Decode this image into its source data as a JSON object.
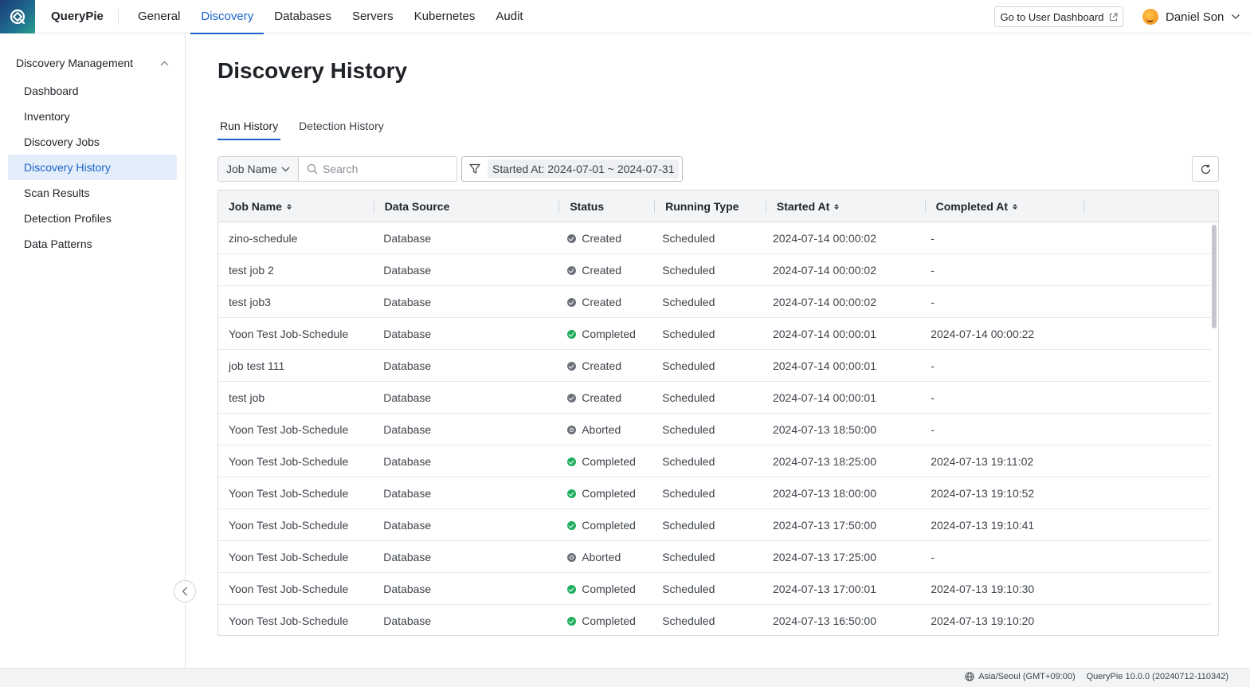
{
  "app": {
    "name": "QueryPie"
  },
  "nav": [
    {
      "label": "General",
      "active": false
    },
    {
      "label": "Discovery",
      "active": true
    },
    {
      "label": "Databases",
      "active": false
    },
    {
      "label": "Servers",
      "active": false
    },
    {
      "label": "Kubernetes",
      "active": false
    },
    {
      "label": "Audit",
      "active": false
    }
  ],
  "header": {
    "dashboard_button": "Go to User Dashboard",
    "user_name": "Daniel Son"
  },
  "sidebar": {
    "section_title": "Discovery Management",
    "items": [
      {
        "label": "Dashboard",
        "active": false
      },
      {
        "label": "Inventory",
        "active": false
      },
      {
        "label": "Discovery Jobs",
        "active": false
      },
      {
        "label": "Discovery History",
        "active": true
      },
      {
        "label": "Scan Results",
        "active": false
      },
      {
        "label": "Detection Profiles",
        "active": false
      },
      {
        "label": "Data Patterns",
        "active": false
      }
    ]
  },
  "main": {
    "title": "Discovery History",
    "tabs": [
      {
        "label": "Run History",
        "active": true
      },
      {
        "label": "Detection History",
        "active": false
      }
    ],
    "filter": {
      "field": "Job Name",
      "search_placeholder": "Search",
      "date_chip": "Started At: 2024-07-01 ~ 2024-07-31"
    },
    "table": {
      "columns": [
        "Job Name",
        "Data Source",
        "Status",
        "Running Type",
        "Started At",
        "Completed At"
      ],
      "rows": [
        {
          "job": "zino-schedule",
          "source": "Database",
          "status": "Created",
          "type": "Scheduled",
          "started": "2024-07-14 00:00:02",
          "completed": "-"
        },
        {
          "job": "test job 2",
          "source": "Database",
          "status": "Created",
          "type": "Scheduled",
          "started": "2024-07-14 00:00:02",
          "completed": "-"
        },
        {
          "job": "test job3",
          "source": "Database",
          "status": "Created",
          "type": "Scheduled",
          "started": "2024-07-14 00:00:02",
          "completed": "-"
        },
        {
          "job": "Yoon Test Job-Schedule",
          "source": "Database",
          "status": "Completed",
          "type": "Scheduled",
          "started": "2024-07-14 00:00:01",
          "completed": "2024-07-14 00:00:22"
        },
        {
          "job": "job test 111",
          "source": "Database",
          "status": "Created",
          "type": "Scheduled",
          "started": "2024-07-14 00:00:01",
          "completed": "-"
        },
        {
          "job": "test job",
          "source": "Database",
          "status": "Created",
          "type": "Scheduled",
          "started": "2024-07-14 00:00:01",
          "completed": "-"
        },
        {
          "job": "Yoon Test Job-Schedule",
          "source": "Database",
          "status": "Aborted",
          "type": "Scheduled",
          "started": "2024-07-13 18:50:00",
          "completed": "-"
        },
        {
          "job": "Yoon Test Job-Schedule",
          "source": "Database",
          "status": "Completed",
          "type": "Scheduled",
          "started": "2024-07-13 18:25:00",
          "completed": "2024-07-13 19:11:02"
        },
        {
          "job": "Yoon Test Job-Schedule",
          "source": "Database",
          "status": "Completed",
          "type": "Scheduled",
          "started": "2024-07-13 18:00:00",
          "completed": "2024-07-13 19:10:52"
        },
        {
          "job": "Yoon Test Job-Schedule",
          "source": "Database",
          "status": "Completed",
          "type": "Scheduled",
          "started": "2024-07-13 17:50:00",
          "completed": "2024-07-13 19:10:41"
        },
        {
          "job": "Yoon Test Job-Schedule",
          "source": "Database",
          "status": "Aborted",
          "type": "Scheduled",
          "started": "2024-07-13 17:25:00",
          "completed": "-"
        },
        {
          "job": "Yoon Test Job-Schedule",
          "source": "Database",
          "status": "Completed",
          "type": "Scheduled",
          "started": "2024-07-13 17:00:01",
          "completed": "2024-07-13 19:10:30"
        },
        {
          "job": "Yoon Test Job-Schedule",
          "source": "Database",
          "status": "Completed",
          "type": "Scheduled",
          "started": "2024-07-13 16:50:00",
          "completed": "2024-07-13 19:10:20"
        }
      ]
    }
  },
  "footer": {
    "timezone": "Asia/Seoul (GMT+09:00)",
    "version": "QueryPie 10.0.0 (20240712-110342)"
  },
  "colors": {
    "accent": "#1a63c9",
    "completed": "#1fae5b",
    "neutral": "#6b7079",
    "active_bg": "#e4eefb"
  },
  "icons": [
    "querypie-logo-icon",
    "external-link-icon",
    "chevron-down-icon",
    "chevron-up-icon",
    "search-icon",
    "filter-icon",
    "refresh-icon",
    "chevron-left-icon",
    "globe-icon",
    "sort-icon",
    "status-created-icon",
    "status-completed-icon",
    "status-aborted-icon"
  ]
}
